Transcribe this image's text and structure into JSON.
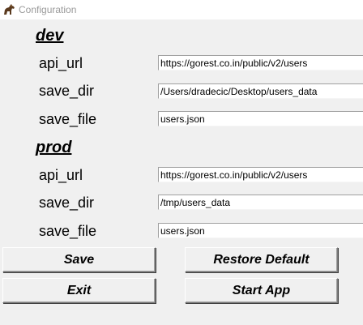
{
  "window": {
    "title": "Configuration"
  },
  "dev": {
    "heading": "dev",
    "api_url": {
      "label": "api_url",
      "value": "https://gorest.co.in/public/v2/users"
    },
    "save_dir": {
      "label": "save_dir",
      "value": "/Users/dradecic/Desktop/users_data"
    },
    "save_file": {
      "label": "save_file",
      "value": "users.json"
    }
  },
  "prod": {
    "heading": "prod",
    "api_url": {
      "label": "api_url",
      "value": "https://gorest.co.in/public/v2/users"
    },
    "save_dir": {
      "label": "save_dir",
      "value": "/tmp/users_data"
    },
    "save_file": {
      "label": "save_file",
      "value": "users.json"
    }
  },
  "buttons": {
    "save": "Save",
    "restore_default": "Restore Default",
    "exit": "Exit",
    "start_app": "Start App"
  },
  "icons": {
    "app": "horse-icon"
  }
}
